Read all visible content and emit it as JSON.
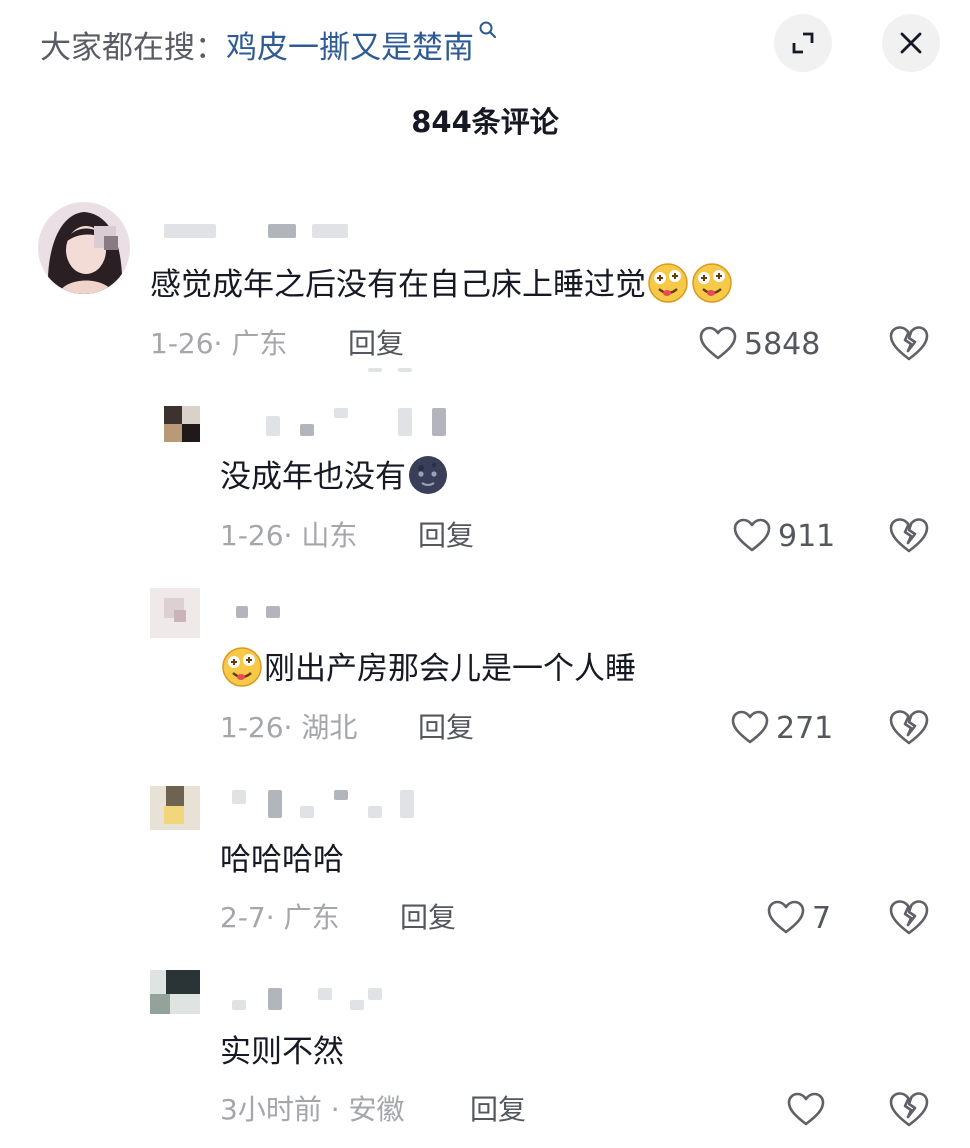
{
  "header": {
    "search_prefix": "大家都在搜：",
    "search_term": "鸡皮一撕又是楚南",
    "search_icon": "search-icon",
    "expand_icon": "expand-icon",
    "close_icon": "close-icon"
  },
  "comments_count_label": "844条评论",
  "colors": {
    "search_term": "#2f5b94",
    "meta": "#a5a6ab",
    "text": "#161823"
  },
  "comments": [
    {
      "text": "感觉成年之后没有在自己床上睡过觉",
      "trailing_emojis": [
        "drooling-face-emoji",
        "drooling-face-emoji"
      ],
      "date_location": "1-26· 广东",
      "reply": "回复",
      "likes": "5848"
    },
    {
      "text": "没成年也没有",
      "trailing_emojis": [
        "new-moon-face-emoji"
      ],
      "date_location": "1-26· 山东",
      "reply": "回复",
      "likes": "911"
    },
    {
      "text": "刚出产房那会儿是一个人睡",
      "leading_emojis": [
        "drooling-face-emoji"
      ],
      "date_location": "1-26· 湖北",
      "reply": "回复",
      "likes": "271"
    },
    {
      "text": "哈哈哈哈",
      "date_location": "2-7· 广东",
      "reply": "回复",
      "likes": "7"
    },
    {
      "text": "实则不然",
      "date_location": "3小时前 · 安徽",
      "reply": "回复",
      "likes": ""
    }
  ]
}
